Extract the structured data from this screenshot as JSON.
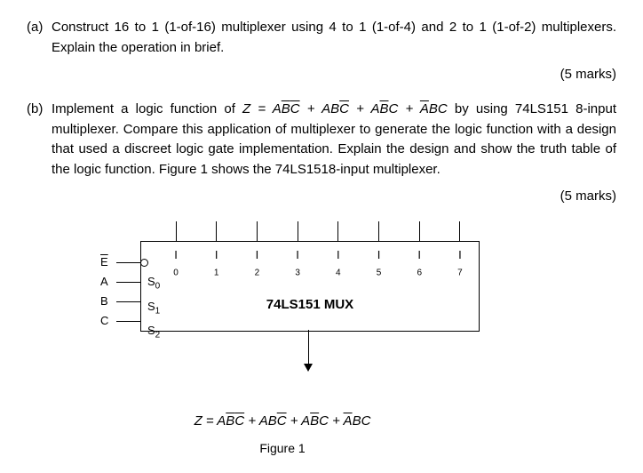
{
  "qa": {
    "label": "(a)",
    "text": "Construct 16 to 1 (1-of-16) multiplexer using 4 to 1 (1-of-4) and 2 to 1 (1-of-2) multiplexers. Explain the operation in brief.",
    "marks": "(5 marks)"
  },
  "qb": {
    "label": "(b)",
    "text1": "Implement a logic function of ",
    "eq_lhs": "Z = ",
    "t1a": "A",
    "t1b": "B",
    "t1c": "C",
    "plus": " + ",
    "t2a": "A",
    "t2b": "B",
    "t2c": "C",
    "t3a": "A",
    "t3b": "B",
    "t3c": "C",
    "t4a": "A",
    "t4b": "B",
    "t4c": "C",
    "text2": " by using 74LS151 8-input multiplexer. Compare this application of multiplexer to generate the logic function with a design that used a discreet logic gate implementation. Explain the design and show the truth table of the logic function. Figure 1 shows the 74LS1518-input multiplexer.",
    "marks": "(5 marks)"
  },
  "mux": {
    "title": "74LS151 MUX",
    "enable": "E",
    "sel_in": [
      "A",
      "B",
      "C"
    ],
    "sel_lab": [
      "S",
      "S",
      "S"
    ],
    "sel_sub": [
      "0",
      "1",
      "2"
    ],
    "in_lab": [
      "I",
      "I",
      "I",
      "I",
      "I",
      "I",
      "I",
      "I"
    ],
    "in_sub": [
      "0",
      "1",
      "2",
      "3",
      "4",
      "5",
      "6",
      "7"
    ]
  },
  "out_eq": {
    "lhs": "Z = ",
    "a": "A",
    "b": "B",
    "c": "C",
    "plus": " + "
  },
  "fig_caption": "Figure 1"
}
